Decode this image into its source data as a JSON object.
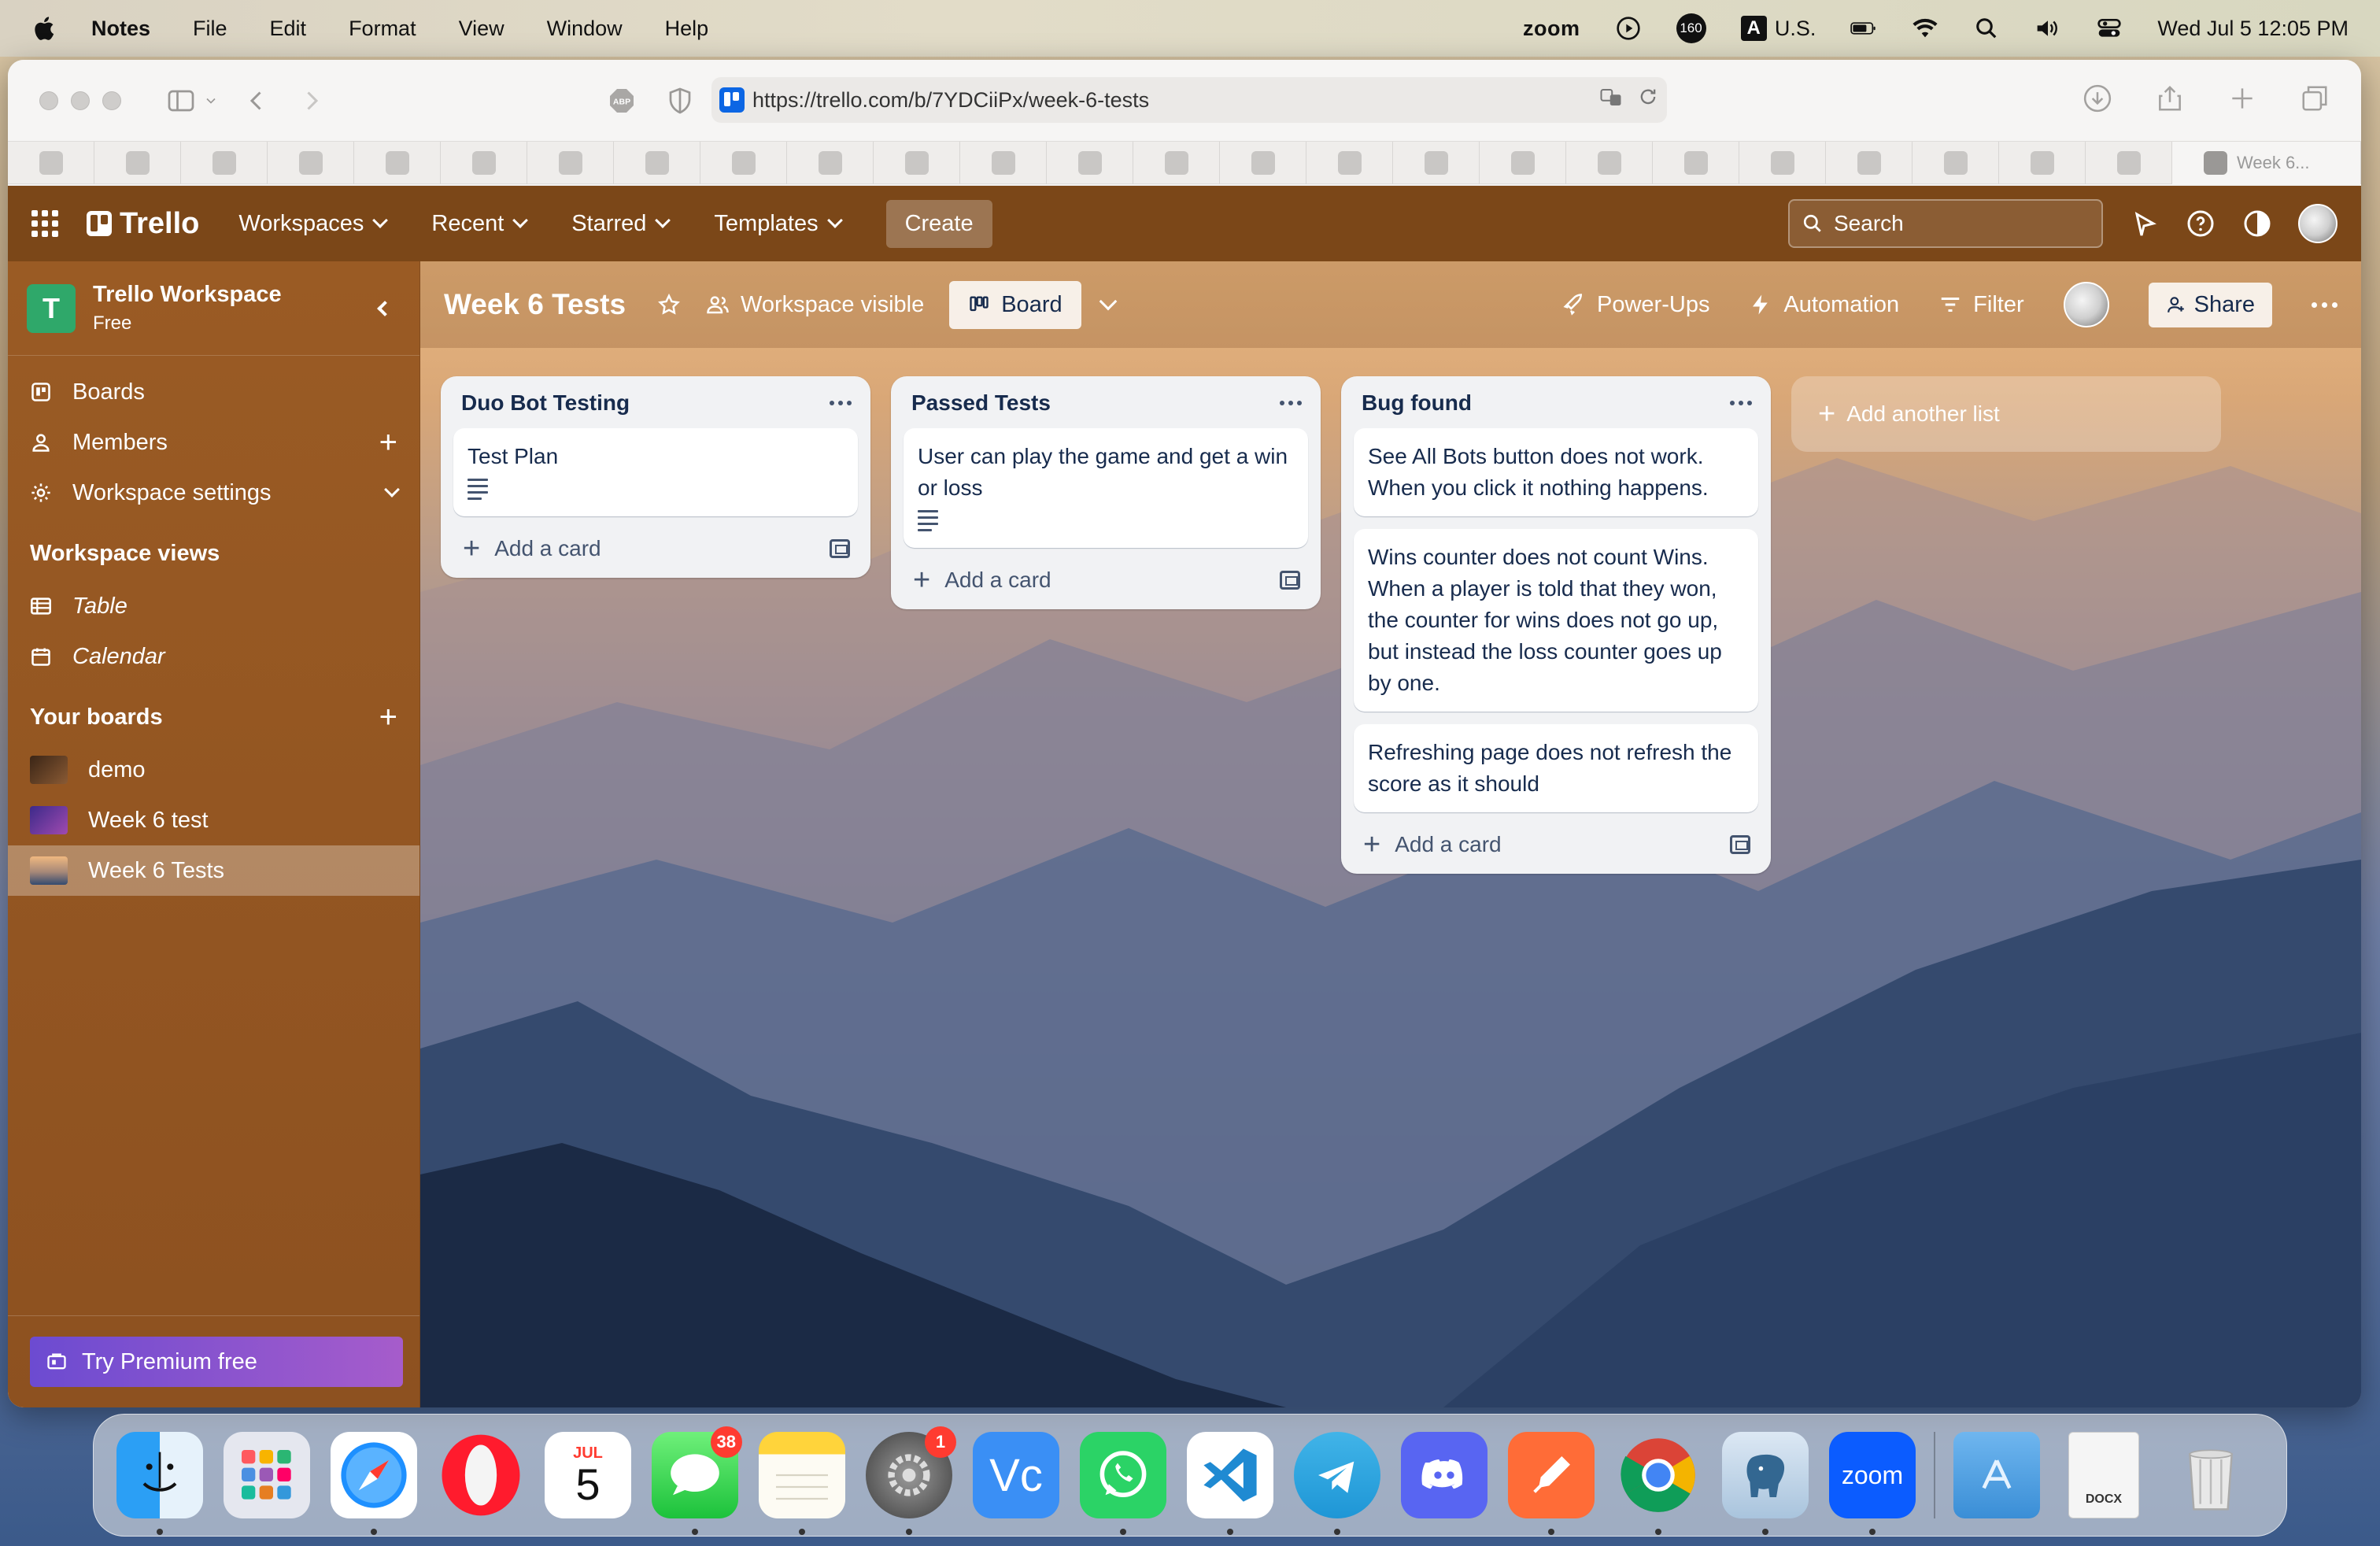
{
  "menubar": {
    "app_name": "Notes",
    "menus": [
      "File",
      "Edit",
      "Format",
      "View",
      "Window",
      "Help"
    ],
    "zoom_label": "zoom",
    "badge_160": "160",
    "input_source": "A",
    "input_locale": "U.S.",
    "datetime": "Wed Jul 5  12:05 PM"
  },
  "browser": {
    "url": "https://trello.com/b/7YDCiiPx/week-6-tests",
    "active_tab_label": "Week 6...",
    "favorites_count": 25
  },
  "trello": {
    "logo": "Trello",
    "nav": {
      "workspaces": "Workspaces",
      "recent": "Recent",
      "starred": "Starred",
      "templates": "Templates",
      "create": "Create"
    },
    "search_placeholder": "Search",
    "sidebar": {
      "workspace_initial": "T",
      "workspace_name": "Trello Workspace",
      "workspace_plan": "Free",
      "items": {
        "boards": "Boards",
        "members": "Members",
        "settings": "Workspace settings"
      },
      "views_header": "Workspace views",
      "views": {
        "table": "Table",
        "calendar": "Calendar"
      },
      "your_boards_header": "Your boards",
      "boards": [
        {
          "name": "demo",
          "color": "#5a3b22"
        },
        {
          "name": "Week 6 test",
          "color": "#6a3aa0"
        },
        {
          "name": "Week 6 Tests",
          "color": "#c89060"
        }
      ],
      "premium": "Try Premium free"
    },
    "board": {
      "title": "Week 6 Tests",
      "visibility": "Workspace visible",
      "view": "Board",
      "powerups": "Power-Ups",
      "automation": "Automation",
      "filter": "Filter",
      "share": "Share"
    },
    "lists": [
      {
        "title": "Duo Bot Testing",
        "cards": [
          {
            "text": "Test Plan",
            "has_description": true
          }
        ],
        "add_card": "Add a card"
      },
      {
        "title": "Passed Tests",
        "cards": [
          {
            "text": "User can play the game and get a win or loss",
            "has_description": true
          }
        ],
        "add_card": "Add a card"
      },
      {
        "title": "Bug found",
        "cards": [
          {
            "text": "See All Bots button does not work. When you click it nothing happens.",
            "has_description": false
          },
          {
            "text": "Wins counter does not count Wins. When a player is told that they won, the counter for wins does not go up, but instead the loss counter goes up by one.",
            "has_description": false
          },
          {
            "text": "Refreshing page does not refresh the score as it should",
            "has_description": false
          }
        ],
        "add_card": "Add a card"
      }
    ],
    "add_list": "Add another list"
  },
  "dock": {
    "calendar_month": "JUL",
    "calendar_day": "5",
    "messages_badge": "38",
    "settings_badge": "1",
    "zoom_label": "zoom",
    "docx_label": "DOCX",
    "apps": [
      "finder",
      "launchpad",
      "safari",
      "opera",
      "calendar",
      "messages",
      "notes",
      "system-settings",
      "vnc",
      "whatsapp",
      "vscode",
      "telegram",
      "discord",
      "postman",
      "chrome",
      "postgres",
      "zoom"
    ]
  }
}
